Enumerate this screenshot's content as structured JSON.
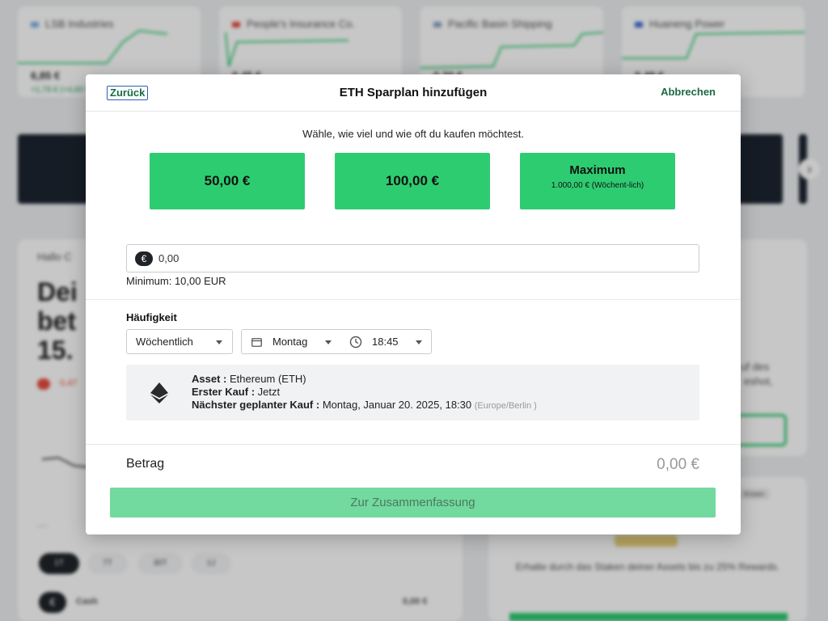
{
  "background": {
    "tickers": [
      {
        "name": "LSB Industries",
        "price": "6,85 €",
        "change": "+1,79 € (+4,60 %)",
        "color": "#7fb2e5",
        "line": "#2ecc71"
      },
      {
        "name": "People's Insurance Co.",
        "price": "0,45 €",
        "change": "",
        "color": "#e74c3c",
        "line": "#2ecc71"
      },
      {
        "name": "Pacific Basin Shipping",
        "price": "0,20 €",
        "change": "",
        "color": "#8aa4c8",
        "line": "#2ecc71"
      },
      {
        "name": "Huaneng Power",
        "price": "0,49 €",
        "change": "",
        "color": "#3b6fd6",
        "line": "#2ecc71"
      }
    ],
    "greeting": "Hallo C",
    "heading_lines": [
      "Dei",
      "bet",
      "15."
    ],
    "loss_text": "0,47",
    "right_text_1": "uf des",
    "right_text_2": "eshot,",
    "right_badge": "Krisen",
    "staking_text": "Erhalte durch das Staken deiner Assets bis zu 25% Rewards.",
    "time_pills": [
      "1T",
      "7T",
      "30T",
      "1J"
    ],
    "cash_label": "Cash",
    "cash_value": "0,00 €",
    "dash": "—"
  },
  "modal": {
    "back_label": "Zurück",
    "title": "ETH Sparplan hinzufügen",
    "cancel_label": "Abbrechen",
    "subtitle": "Wähle, wie viel und wie oft du kaufen möchtest.",
    "presets": [
      {
        "label": "50,00 €"
      },
      {
        "label": "100,00 €"
      },
      {
        "label": "Maximum",
        "sub": "1.000,00 € (Wöchent-lich)"
      }
    ],
    "amount_input": {
      "currency_symbol": "€",
      "value": "0,00"
    },
    "minimum_text": "Minimum: 10,00 EUR",
    "frequency": {
      "label": "Häufigkeit",
      "interval": "Wöchentlich",
      "day": "Montag",
      "time": "18:45"
    },
    "info": {
      "asset_label": "Asset :",
      "asset_value": "Ethereum (ETH)",
      "first_label": "Erster Kauf :",
      "first_value": "Jetzt",
      "next_label": "Nächster geplanter Kauf :",
      "next_value": "Montag, Januar 20. 2025, 18:30",
      "timezone": "(Europe/Berlin )"
    },
    "amount_label": "Betrag",
    "amount_value": "0,00 €",
    "summary_button": "Zur Zusammenfassung"
  },
  "colors": {
    "accent_green": "#2ecc71",
    "link_green": "#1a6a44",
    "disabled_green": "#72d99f"
  }
}
